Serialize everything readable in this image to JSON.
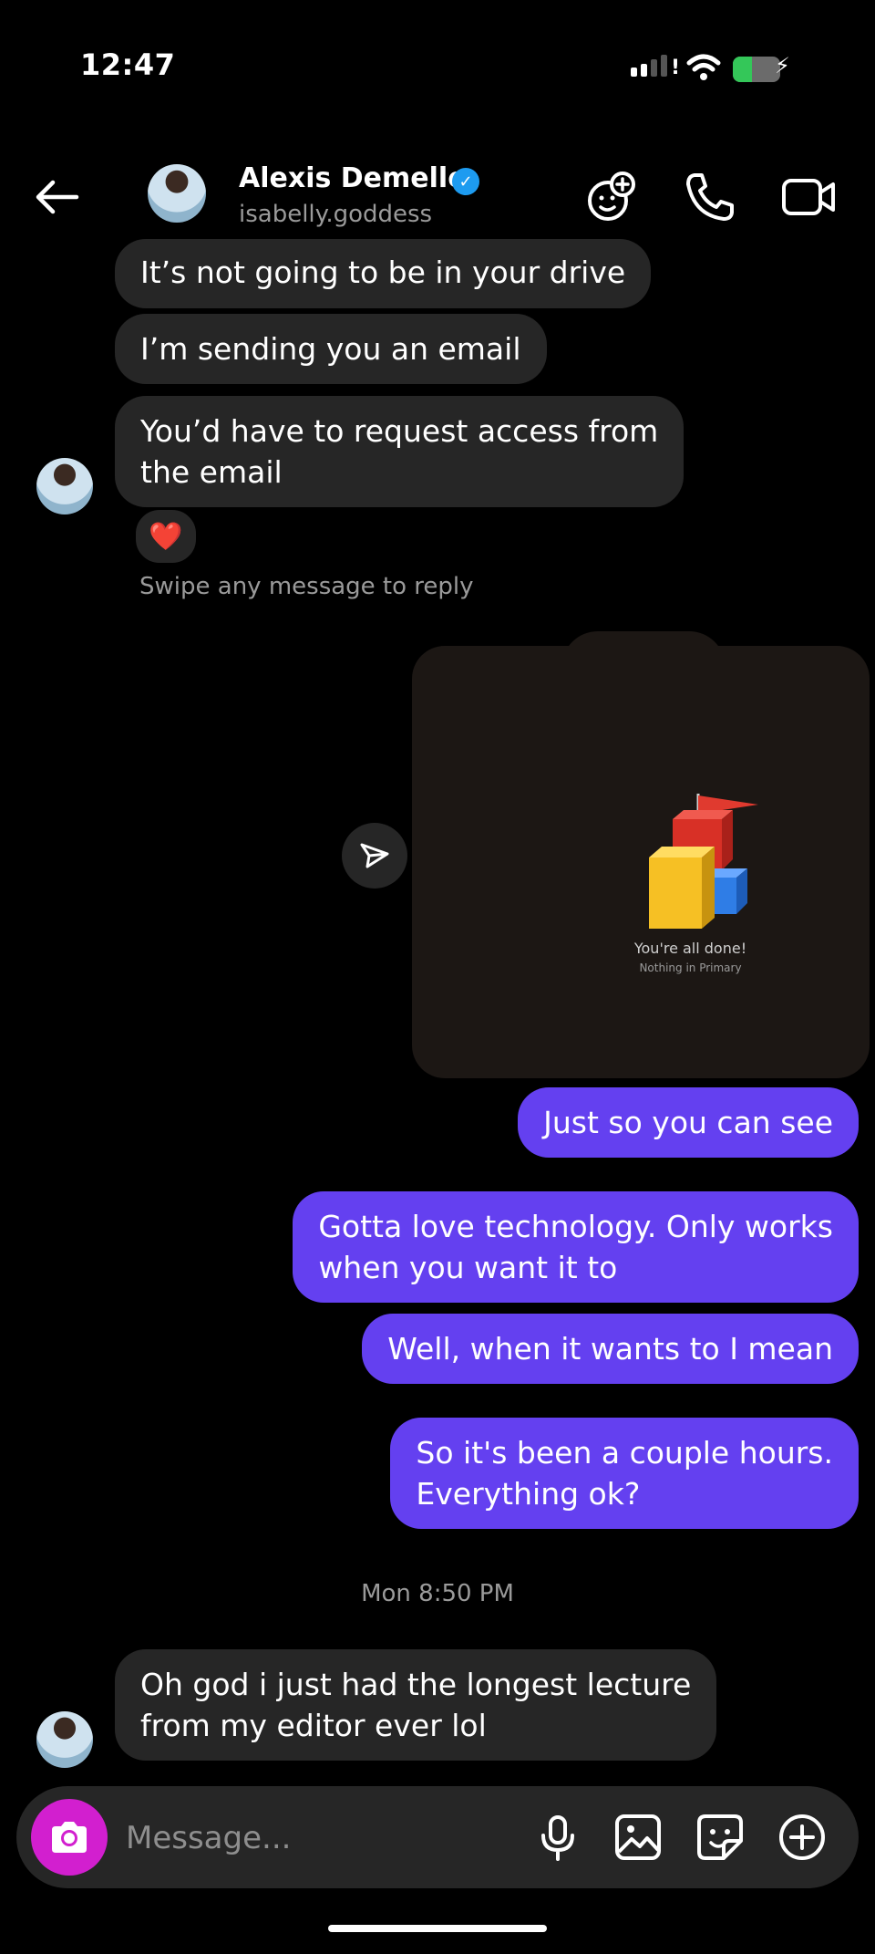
{
  "status_bar": {
    "time": "12:47",
    "battery_level": 0.4
  },
  "header": {
    "name": "Alexis Demello",
    "username": "isabelly.goddess",
    "verified": true,
    "icons": [
      "back-arrow-icon",
      "add-effect-icon",
      "phone-icon",
      "video-icon"
    ]
  },
  "messages": {
    "incoming_1": "It’s not going to be in your drive",
    "incoming_2": "I’m sending you an email",
    "incoming_3_line1": "You’d have to request access from",
    "incoming_3_line2": "the email",
    "reaction": "❤️",
    "swipe_hint": "Swipe any message to reply",
    "shared_image": {
      "title": "You're all done!",
      "subtitle": "Nothing in Primary"
    },
    "outgoing_1": "Just so you can see",
    "outgoing_2_line1": "Gotta love technology. Only works",
    "outgoing_2_line2": "when you want it to",
    "outgoing_3": "Well, when it wants to I mean",
    "outgoing_4_line1": "So it's been a couple hours.",
    "outgoing_4_line2": "Everything ok?",
    "timestamp": "Mon 8:50 PM",
    "incoming_4_line1": "Oh god i just had the longest lecture",
    "incoming_4_line2": "from my editor ever lol"
  },
  "composer": {
    "placeholder": "Message...",
    "icons": [
      "camera-icon",
      "microphone-icon",
      "gallery-icon",
      "sticker-icon",
      "plus-icon"
    ]
  },
  "colors": {
    "outgoing_bubble": "#6440f0",
    "incoming_bubble": "#262626",
    "camera_button": "#d21fcf",
    "verified": "#1d9bf0"
  }
}
